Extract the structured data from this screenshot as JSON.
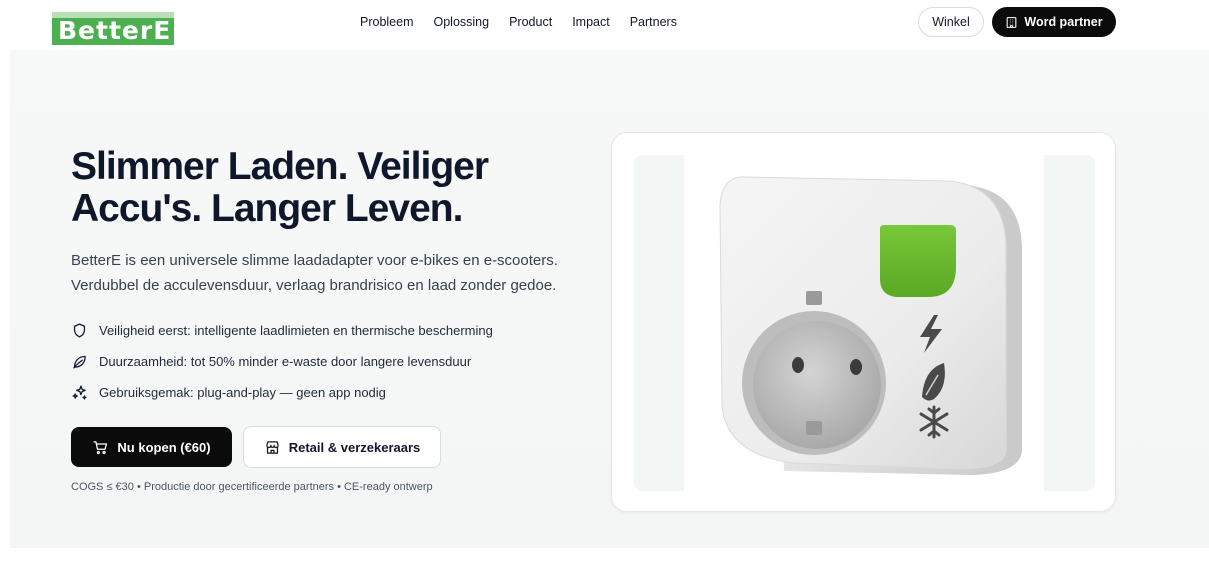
{
  "header": {
    "logo_text": "BetterE",
    "nav": [
      "Probleem",
      "Oplossing",
      "Product",
      "Impact",
      "Partners"
    ],
    "shop_label": "Winkel",
    "partner_label": "Word partner"
  },
  "hero": {
    "headline_line1": "Slimmer Laden. Veiliger",
    "headline_line2": "Accu's. Langer Leven.",
    "intro_line1": "BetterE is een universele slimme laadadapter voor e-bikes en e-scooters.",
    "intro_line2": "Verdubbel de acculevensduur, verlaag brandrisico en laad zonder gedoe.",
    "features": [
      "Veiligheid eerst: intelligente laadlimieten en thermische bescherming",
      "Duurzaamheid: tot 50% minder e-waste door langere levensduur",
      "Gebruiksgemak: plug-and-play — geen app nodig"
    ],
    "buy_label": "Nu kopen (€60)",
    "retail_label": "Retail & verzekeraars",
    "footnote": "COGS ≤ €30 • Productie door gecertificeerde partners • CE-ready ontwerp"
  },
  "icons": {
    "feature_icons": [
      "shield-icon",
      "leaf-icon",
      "sparkles-icon"
    ],
    "buy_icon": "cart-icon",
    "retail_icon": "store-icon",
    "partner_icon": "building-icon"
  },
  "colors": {
    "brand_green": "#4caf50",
    "device_leaf_green": "#6cc030",
    "primary_button": "#0b0b0b"
  }
}
